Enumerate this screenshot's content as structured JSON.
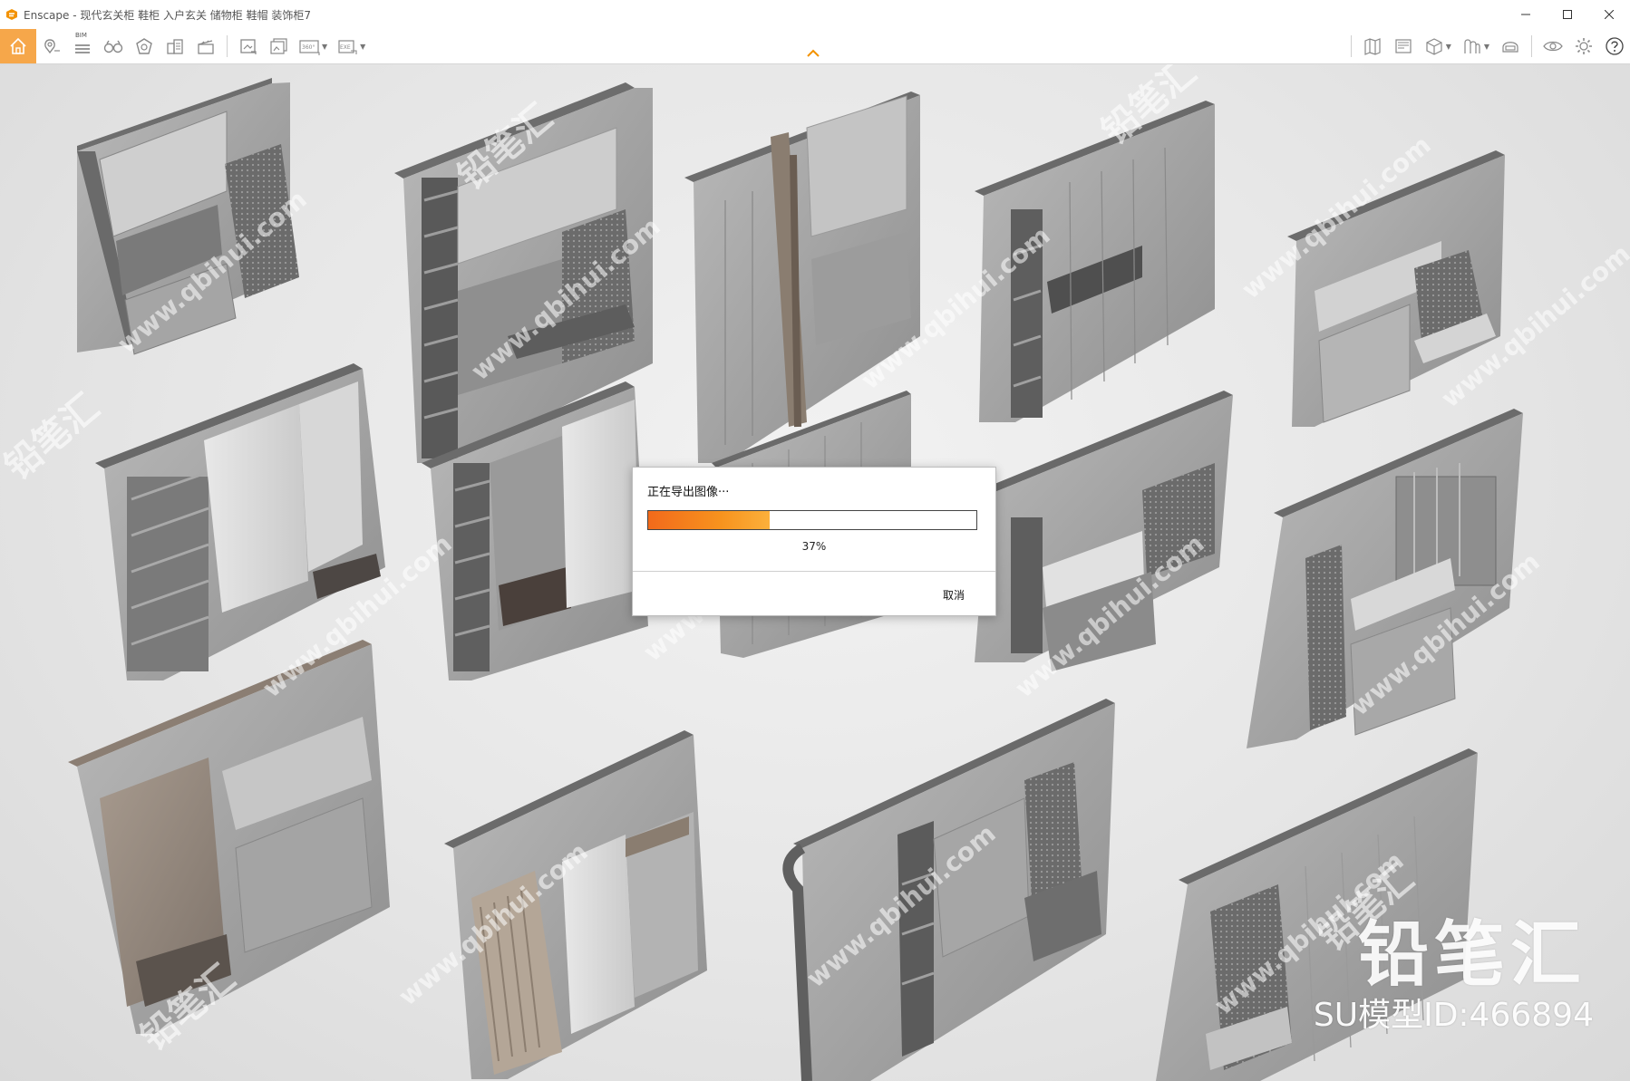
{
  "window": {
    "title": "Enscape - 现代玄关柜 鞋柜 入户玄关 储物柜 鞋帽 装饰柜7",
    "accent_color": "#f6a74a"
  },
  "toolbar": {
    "left_icons": [
      "home-icon",
      "location-pin-icon",
      "bim-list-icon",
      "binoculars-icon",
      "asset-library-icon",
      "buildings-icon",
      "video-clapper-icon",
      "render-screenshot-icon",
      "batch-render-icon",
      "panorama-360-icon",
      "export-exe-icon"
    ],
    "bim_label": "BIM",
    "panorama_label": "360°",
    "exe_label": "EXE",
    "right_icons": [
      "map-icon",
      "views-icon",
      "cube-icon",
      "materials-icon",
      "helmet-icon",
      "eye-icon",
      "settings-icon",
      "help-icon"
    ]
  },
  "dialog": {
    "title": "正在导出图像···",
    "progress": 0.37,
    "progress_text": "37%",
    "cancel_label": "取消",
    "progress_colors": [
      "#f26a1b",
      "#fbb03b"
    ]
  },
  "watermark": {
    "brand": "铅笔汇",
    "model_id": "SU模型ID:466894",
    "url": "www.qbihui.com"
  }
}
